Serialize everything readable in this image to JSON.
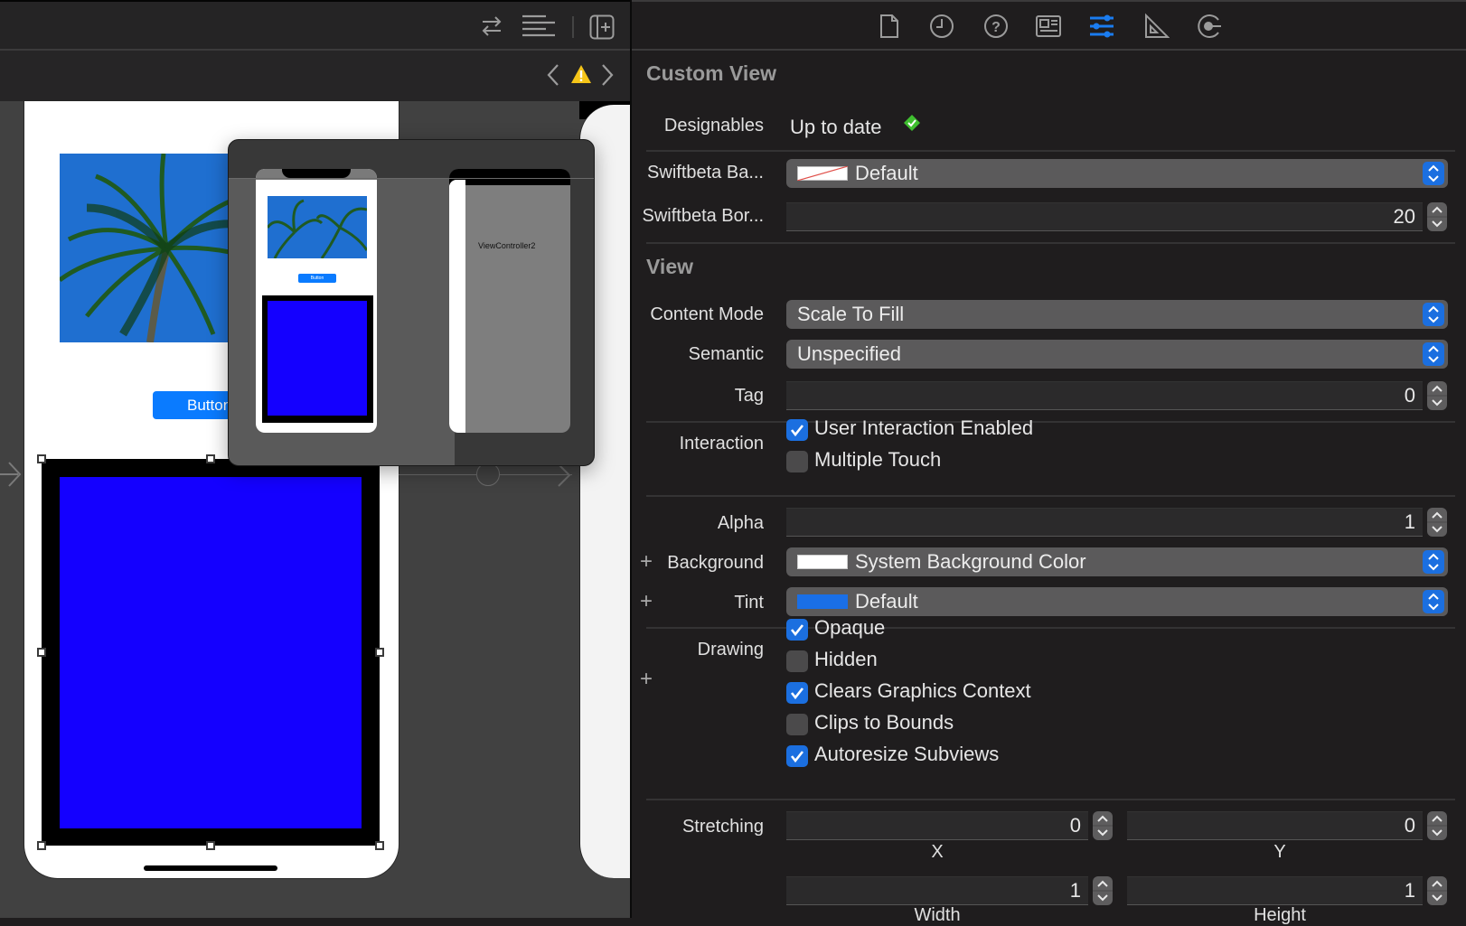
{
  "canvas": {
    "toolbar": {
      "icons": [
        "arrows-swap-icon",
        "lines-align-icon",
        "add-editor-icon"
      ]
    },
    "jumpbar": {
      "icons": [
        "chevron-left-icon",
        "warning-icon",
        "chevron-right-icon"
      ]
    },
    "scene1": {
      "button_label": "Button",
      "selected_view_color": "#1400ff",
      "frame_color": "#000000"
    },
    "preview": {
      "mini_button_label": "Button",
      "second_scene_label": "ViewController2"
    }
  },
  "inspector": {
    "tabs": [
      {
        "name": "file-icon",
        "active": false
      },
      {
        "name": "history-icon",
        "active": false
      },
      {
        "name": "help-icon",
        "active": false
      },
      {
        "name": "identity-icon",
        "active": false
      },
      {
        "name": "attributes-icon",
        "active": true
      },
      {
        "name": "size-icon",
        "active": false
      },
      {
        "name": "connections-icon",
        "active": false
      }
    ],
    "accent_color": "#1a7cf0",
    "custom_view": {
      "title": "Custom View",
      "designables_label": "Designables",
      "designables_value": "Up to date",
      "designables_status_color": "#3fbf2f",
      "border_color_label": "Swiftbeta Ba...",
      "border_color_value": "Default",
      "border_width_label": "Swiftbeta Bor...",
      "border_width_value": "20"
    },
    "view": {
      "title": "View",
      "content_mode_label": "Content Mode",
      "content_mode_value": "Scale To Fill",
      "semantic_label": "Semantic",
      "semantic_value": "Unspecified",
      "tag_label": "Tag",
      "tag_value": "0",
      "interaction_label": "Interaction",
      "interaction_options": [
        {
          "label": "User Interaction Enabled",
          "checked": true
        },
        {
          "label": "Multiple Touch",
          "checked": false
        }
      ],
      "alpha_label": "Alpha",
      "alpha_value": "1",
      "background_label": "Background",
      "background_value": "System Background Color",
      "background_swatch": "#ffffff",
      "tint_label": "Tint",
      "tint_value": "Default",
      "tint_swatch": "#1a6fe6",
      "drawing_label": "Drawing",
      "drawing_options": [
        {
          "label": "Opaque",
          "checked": true
        },
        {
          "label": "Hidden",
          "checked": false
        },
        {
          "label": "Clears Graphics Context",
          "checked": true
        },
        {
          "label": "Clips to Bounds",
          "checked": false
        },
        {
          "label": "Autoresize Subviews",
          "checked": true
        }
      ],
      "stretching_label": "Stretching",
      "stretching": {
        "x_value": "0",
        "x_label": "X",
        "y_value": "0",
        "y_label": "Y",
        "width_value": "1",
        "width_label": "Width",
        "height_value": "1",
        "height_label": "Height"
      }
    }
  }
}
